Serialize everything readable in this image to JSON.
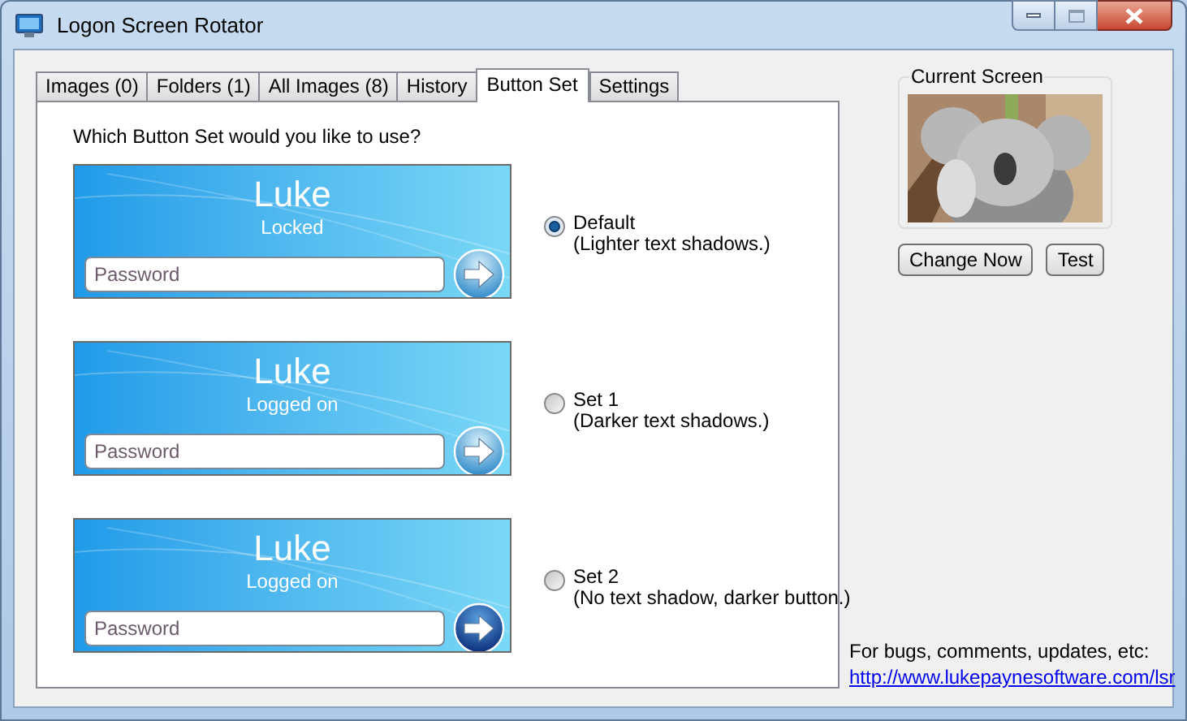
{
  "window": {
    "title": "Logon Screen Rotator"
  },
  "tabs": [
    {
      "label": "Images (0)",
      "selected": false
    },
    {
      "label": "Folders (1)",
      "selected": false
    },
    {
      "label": "All Images (8)",
      "selected": false
    },
    {
      "label": "History",
      "selected": false
    },
    {
      "label": "Button Set",
      "selected": true
    },
    {
      "label": "Settings",
      "selected": false
    }
  ],
  "question": "Which Button Set would you like to use?",
  "button_sets": [
    {
      "user": "Luke",
      "status": "Locked",
      "placeholder": "Password",
      "kind": "light",
      "label": "Default",
      "description": "(Lighter text shadows.)",
      "selected": true
    },
    {
      "user": "Luke",
      "status": "Logged on",
      "placeholder": "Password",
      "kind": "light",
      "label": "Set 1",
      "description": "(Darker text shadows.)",
      "selected": false
    },
    {
      "user": "Luke",
      "status": "Logged on",
      "placeholder": "Password",
      "kind": "dark",
      "label": "Set 2",
      "description": "(No text shadow, darker button.)",
      "selected": false
    }
  ],
  "current_screen": {
    "title": "Current Screen"
  },
  "buttons": [
    "Change Now",
    "Test"
  ],
  "footer": {
    "text": "For bugs, comments, updates, etc:",
    "link": "http://www.lukepaynesoftware.com/lsr"
  }
}
